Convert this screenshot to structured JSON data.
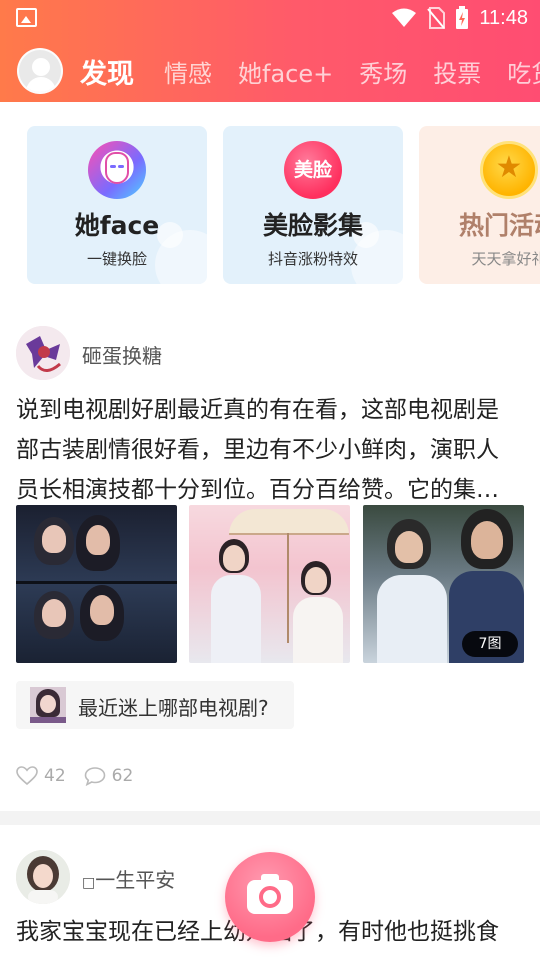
{
  "status_bar": {
    "time": "11:48",
    "icons": [
      "image-icon",
      "wifi-icon",
      "no-sim-icon",
      "battery-charging-icon"
    ]
  },
  "nav": {
    "tabs": [
      {
        "label": "发现",
        "active": true
      },
      {
        "label": "情感",
        "active": false
      },
      {
        "label": "她face+",
        "active": false
      },
      {
        "label": "秀场",
        "active": false
      },
      {
        "label": "投票",
        "active": false
      },
      {
        "label": "吃货",
        "active": false
      }
    ]
  },
  "feature_cards": [
    {
      "title": "她face",
      "subtitle": "一键换脸",
      "icon": "mask-icon"
    },
    {
      "title": "美脸影集",
      "subtitle": "抖音涨粉特效",
      "icon_text": "美脸",
      "icon": "meilian-icon"
    },
    {
      "title": "热门活动",
      "subtitle": "天天拿好礼",
      "icon": "coin-star-icon"
    }
  ],
  "posts": [
    {
      "author": "砸蛋换糖",
      "text": "说到电视剧好剧最近真的有在看，这部电视剧是部古装剧情很好看，里边有不少小鲜肉，演职人员长相演技都十分到位。百分百给赞。它的集…",
      "text_lines": [
        "说到电视剧好剧最近真的有在看，这部电视剧是",
        "部古装剧情很好看，里边有不少小鲜肉，演职人",
        "员长相演技都十分到位。百分百给赞。它的集…"
      ],
      "image_count_label": "7图",
      "topic": "最近迷上哪部电视剧?",
      "likes": "42",
      "comments": "62"
    },
    {
      "author": "一生平安",
      "author_prefix": "□",
      "text_line": "我家宝宝现在已经上幼儿园了，有时他也挺挑食"
    }
  ],
  "colors": {
    "header_start": "#ff7a4a",
    "header_end": "#ff4d72",
    "camera_fab": "#ff6b88"
  }
}
